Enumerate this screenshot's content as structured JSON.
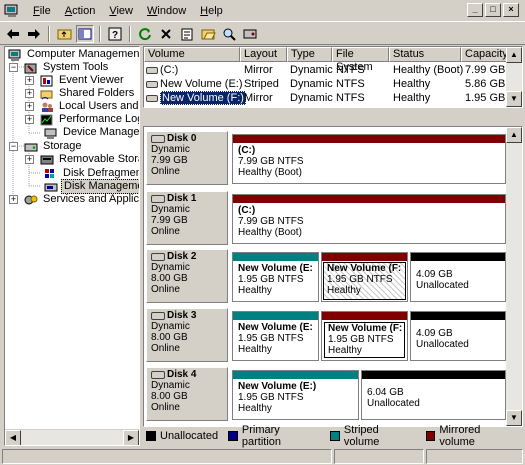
{
  "menubar": {
    "items": [
      {
        "label": "File",
        "accel": "F",
        "rest": "ile"
      },
      {
        "label": "Action",
        "accel": "A",
        "rest": "ction"
      },
      {
        "label": "View",
        "accel": "V",
        "rest": "iew"
      },
      {
        "label": "Window",
        "accel": "W",
        "rest": "indow"
      },
      {
        "label": "Help",
        "accel": "H",
        "rest": "elp"
      }
    ],
    "window_controls": [
      "_",
      "□",
      "×"
    ]
  },
  "toolbar": {
    "buttons": [
      "back-arrow-icon",
      "forward-arrow-icon",
      "up-folder-icon",
      "show-hide-tree-icon",
      "help-icon",
      "refresh-icon",
      "delete-icon",
      "properties-icon",
      "open-icon",
      "search-icon",
      "disk-settings-icon"
    ]
  },
  "tree": {
    "root": "Computer Management (Local)",
    "system_tools": "System Tools",
    "event_viewer": "Event Viewer",
    "shared_folders": "Shared Folders",
    "local_users": "Local Users and Groups",
    "performance": "Performance Logs and Alerts",
    "device_manager": "Device Manager",
    "storage": "Storage",
    "removable": "Removable Storage",
    "defrag": "Disk Defragmenter",
    "disk_mgmt": "Disk Management",
    "services": "Services and Applications"
  },
  "volumes": {
    "headers": {
      "volume": "Volume",
      "layout": "Layout",
      "type": "Type",
      "fs": "File System",
      "status": "Status",
      "capacity": "Capacity"
    },
    "rows": [
      {
        "volume": "(C:)",
        "layout": "Mirror",
        "type": "Dynamic",
        "fs": "NTFS",
        "status": "Healthy (Boot)",
        "capacity": "7.99 GB"
      },
      {
        "volume": "New Volume (E:)",
        "layout": "Striped",
        "type": "Dynamic",
        "fs": "NTFS",
        "status": "Healthy",
        "capacity": "5.86 GB"
      },
      {
        "volume": "New Volume (F:)",
        "layout": "Mirror",
        "type": "Dynamic",
        "fs": "NTFS",
        "status": "Healthy",
        "capacity": "1.95 GB"
      }
    ]
  },
  "disks": [
    {
      "name": "Disk 0",
      "type": "Dynamic",
      "size": "7.99 GB",
      "state": "Online",
      "parts": [
        {
          "title": "(C:)",
          "size": "7.99 GB NTFS",
          "status": "Healthy (Boot)"
        }
      ]
    },
    {
      "name": "Disk 1",
      "type": "Dynamic",
      "size": "7.99 GB",
      "state": "Online",
      "parts": [
        {
          "title": "(C:)",
          "size": "7.99 GB NTFS",
          "status": "Healthy (Boot)"
        }
      ]
    },
    {
      "name": "Disk 2",
      "type": "Dynamic",
      "size": "8.00 GB",
      "state": "Online",
      "parts": [
        {
          "title": "New Volume  (E:",
          "size": "1.95 GB NTFS",
          "status": "Healthy"
        },
        {
          "title": "New Volume  (F:",
          "size": "1.95 GB NTFS",
          "status": "Healthy"
        },
        {
          "title": "",
          "size": "4.09 GB",
          "status": "Unallocated"
        }
      ]
    },
    {
      "name": "Disk 3",
      "type": "Dynamic",
      "size": "8.00 GB",
      "state": "Online",
      "parts": [
        {
          "title": "New Volume  (E:",
          "size": "1.95 GB NTFS",
          "status": "Healthy"
        },
        {
          "title": "New Volume  (F:",
          "size": "1.95 GB NTFS",
          "status": "Healthy"
        },
        {
          "title": "",
          "size": "4.09 GB",
          "status": "Unallocated"
        }
      ]
    },
    {
      "name": "Disk 4",
      "type": "Dynamic",
      "size": "8.00 GB",
      "state": "Online",
      "parts": [
        {
          "title": "New Volume  (E:)",
          "size": "1.95 GB NTFS",
          "status": "Healthy"
        },
        {
          "title": "",
          "size": "6.04 GB",
          "status": "Unallocated"
        }
      ]
    }
  ],
  "legend": [
    {
      "label": "Unallocated",
      "color": "#000000"
    },
    {
      "label": "Primary partition",
      "color": "#000080"
    },
    {
      "label": "Striped volume",
      "color": "#008080"
    },
    {
      "label": "Mirrored volume",
      "color": "#800000"
    }
  ],
  "colors": {
    "unallocated": "#000000",
    "striped": "#008080",
    "mirrored": "#800000",
    "selection": "#0a246a"
  }
}
